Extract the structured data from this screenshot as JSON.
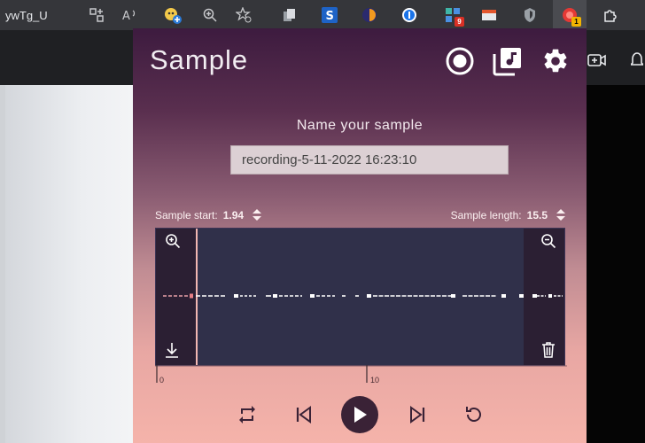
{
  "browser": {
    "tab_fragment": "ywTg_U",
    "badges": {
      "extension_red": "9",
      "recorder": "1"
    }
  },
  "popup": {
    "title": "Sample",
    "name_label": "Name your sample",
    "sample_name": "recording-5-11-2022 16:23:10",
    "sample_start_label": "Sample start:",
    "sample_start_value": "1.94",
    "sample_length_label": "Sample length:",
    "sample_length_value": "15.5",
    "timeline": {
      "tick_0": "0",
      "tick_10": "10"
    }
  },
  "colors": {
    "popup_top": "#3d1b3f",
    "popup_bottom": "#f5b3aa",
    "waveform_bg": "#30304a",
    "waveform_line": "#ffffff"
  }
}
